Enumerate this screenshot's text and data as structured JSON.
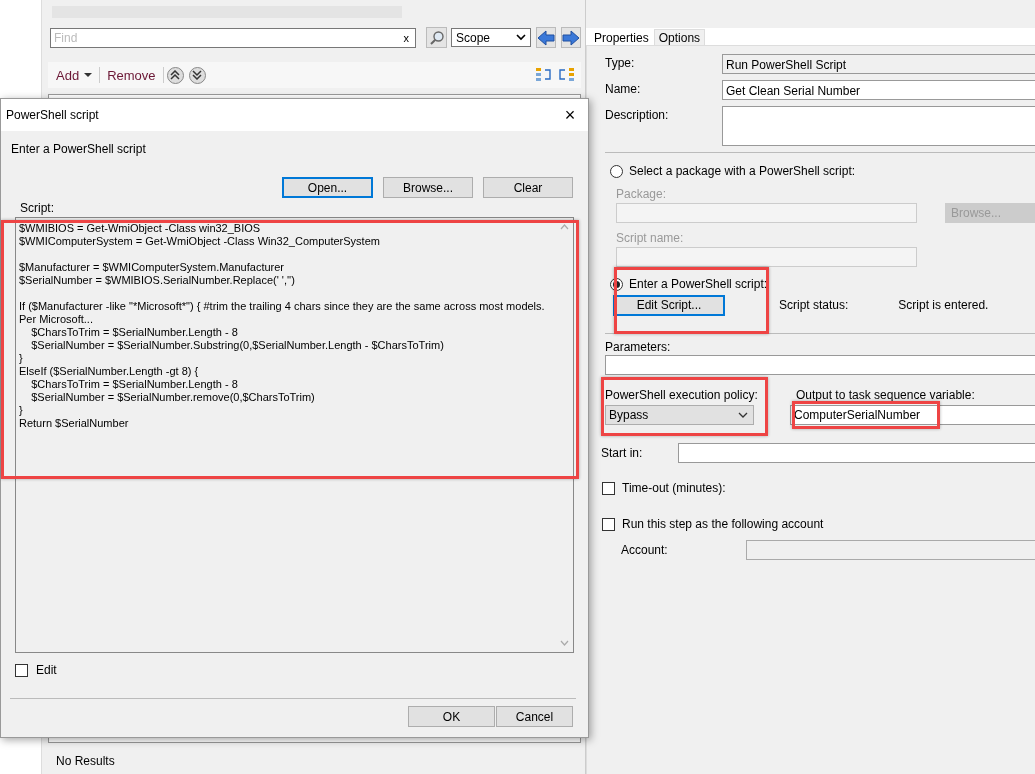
{
  "main_window": {
    "find": {
      "placeholder": "Find",
      "clear": "x"
    },
    "scope": "Scope",
    "toolbar": {
      "add": "Add",
      "remove": "Remove"
    },
    "status": "No Results"
  },
  "properties_panel": {
    "tabs": [
      {
        "label": "Properties",
        "selected": true
      },
      {
        "label": "Options",
        "selected": false
      }
    ],
    "type": {
      "label": "Type:",
      "value": "Run PowerShell Script"
    },
    "name": {
      "label": "Name:",
      "value": "Get Clean Serial Number"
    },
    "description": {
      "label": "Description:"
    },
    "script_source": [
      {
        "label": "Select a package with a PowerShell script:",
        "selected": false
      },
      {
        "label": "Enter a PowerShell script:",
        "selected": true
      }
    ],
    "package": {
      "label": "Package:",
      "disabled": true,
      "browse": "Browse..."
    },
    "script_name": {
      "label": "Script name:",
      "disabled": true
    },
    "edit_script": "Edit Script...",
    "script_status": {
      "label": "Script status:",
      "value": "Script is entered."
    },
    "parameters": {
      "label": "Parameters:"
    },
    "execution_policy": {
      "label": "PowerShell execution policy:",
      "value": "Bypass"
    },
    "output_variable": {
      "label": "Output to task sequence variable:",
      "value": "ComputerSerialNumber"
    },
    "start_in": {
      "label": "Start in:"
    },
    "timeout": {
      "label": "Time-out (minutes):",
      "checked": false
    },
    "run_as": {
      "label": "Run this step as the following account",
      "checked": false
    },
    "account": {
      "label": "Account:",
      "disabled": true
    }
  },
  "dialog": {
    "title": "PowerShell script",
    "close": "×",
    "instruction": "Enter a PowerShell script",
    "buttons": [
      "Open...",
      "Browse...",
      "Clear"
    ],
    "script_label": "Script:",
    "script_blocks": [
      [
        "$WMIBIOS = Get-WmiObject -Class win32_BIOS",
        "$WMIComputerSystem = Get-WmiObject -Class Win32_ComputerSystem"
      ],
      [
        "$Manufacturer = $WMIComputerSystem.Manufacturer",
        "$SerialNumber = $WMIBIOS.SerialNumber.Replace(' ','')"
      ],
      [
        "If ($Manufacturer -like \"*Microsoft*\") { #trim the trailing 4 chars since they are the same across most models. Per Microsoft...",
        "    $CharsToTrim = $SerialNumber.Length - 8",
        "    $SerialNumber = $SerialNumber.Substring(0,$SerialNumber.Length - $CharsToTrim)",
        "}",
        "ElseIf ($SerialNumber.Length -gt 8) {",
        "    $CharsToTrim = $SerialNumber.Length - 8",
        "    $SerialNumber = $SerialNumber.remove(0,$CharsToTrim)",
        "}",
        "Return $SerialNumber"
      ]
    ],
    "edit": {
      "label": "Edit",
      "checked": false
    },
    "ok": "OK",
    "cancel": "Cancel"
  }
}
